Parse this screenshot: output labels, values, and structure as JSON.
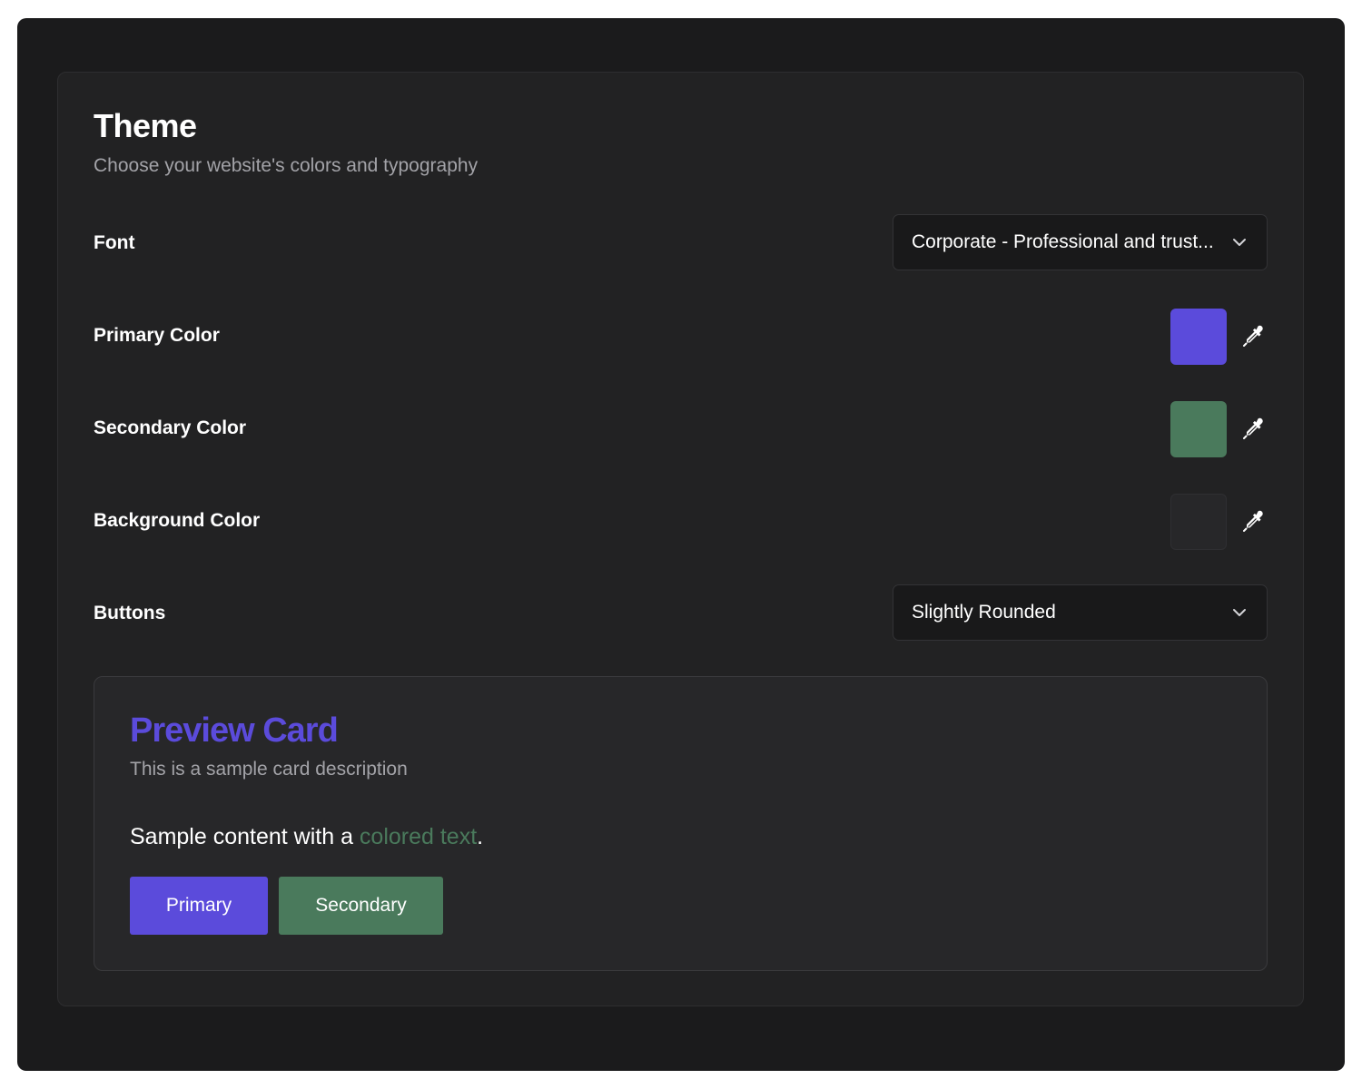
{
  "theme": {
    "title": "Theme",
    "subtitle": "Choose your website's colors and typography"
  },
  "font_setting": {
    "label": "Font",
    "selected": "Corporate - Professional and trust..."
  },
  "primary_color": {
    "label": "Primary Color",
    "value": "#5b4bdb"
  },
  "secondary_color": {
    "label": "Secondary Color",
    "value": "#4a7a5c"
  },
  "background_color": {
    "label": "Background Color",
    "value": "#272729"
  },
  "buttons_setting": {
    "label": "Buttons",
    "selected": "Slightly Rounded"
  },
  "preview": {
    "title": "Preview Card",
    "description": "This is a sample card description",
    "content_prefix": "Sample content with a ",
    "content_highlight": "colored text",
    "content_suffix": ".",
    "primary_button": "Primary",
    "secondary_button": "Secondary"
  },
  "icons": {
    "dropdown": "chevron-down-icon",
    "picker": "eyedropper-icon"
  }
}
